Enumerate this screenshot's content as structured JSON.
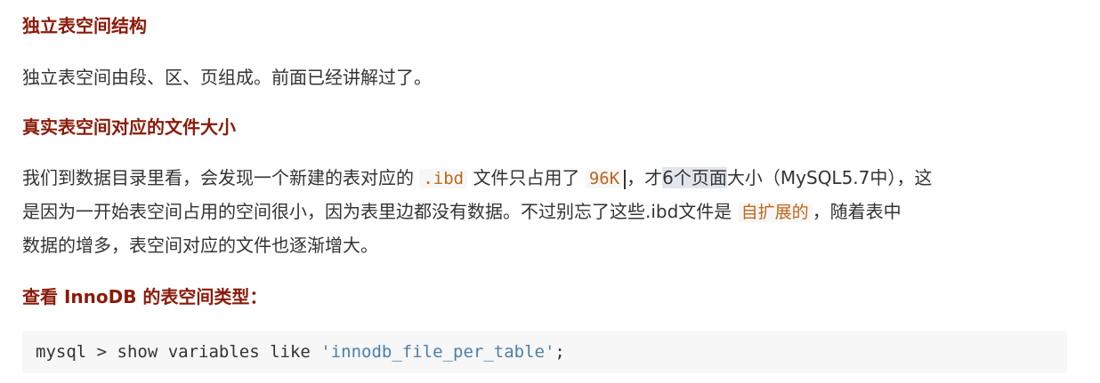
{
  "sections": {
    "heading1": "独立表空间结构",
    "para1": "独立表空间由段、区、页组成。前面已经讲解过了。",
    "heading2": "真实表空间对应的文件大小",
    "para2": {
      "t1": "我们到数据目录里看，会发现一个新建的表对应的 ",
      "code1": ".ibd",
      "t2": " 文件只占用了 ",
      "code2": "96K",
      "t3": "，才",
      "hl": "6个页面",
      "t4": "大小（MySQL5.7中），这",
      "line2a": "是因为一开始表空间占用的空间很小，因为表里边都没有数据。不过别忘了这些.ibd文件是 ",
      "code3": "自扩展的",
      "line2b": "，随着表中",
      "line3": "数据的增多，表空间对应的文件也逐渐增大。"
    },
    "heading3": "查看 InnoDB 的表空间类型：",
    "code_block": {
      "prefix": "mysql > show variables like ",
      "string": "'innodb_file_per_table'",
      "suffix": ";"
    }
  },
  "colors": {
    "heading": "#8b1a0a",
    "inline_code": "#c0661a",
    "code_string": "#4b7fa8"
  }
}
